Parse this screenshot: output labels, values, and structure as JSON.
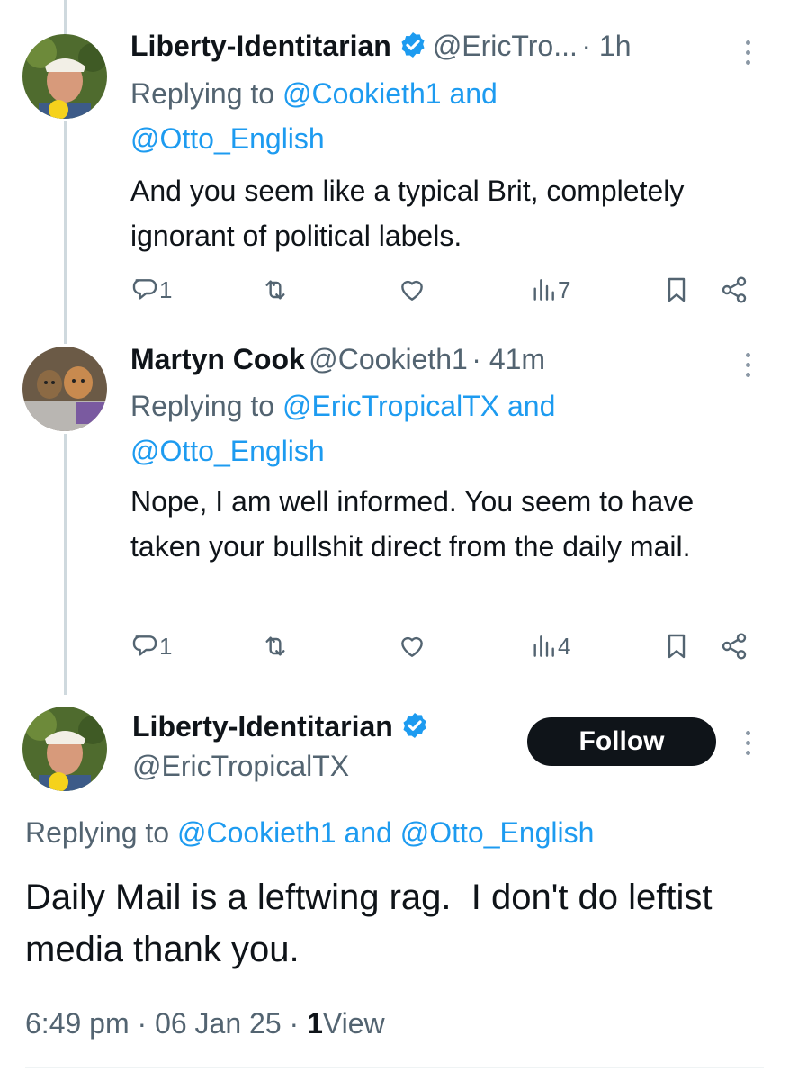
{
  "tweets": [
    {
      "name": "Liberty-Identitarian",
      "handle": "@EricTro...",
      "time": "· 1h",
      "replying_prefix": "Replying to",
      "replying_user1": "@Cookieth1",
      "replying_and": "and",
      "replying_user2": "@Otto_English",
      "text": "And you seem like a typical Brit, completely ignorant of political labels.",
      "replies": "1",
      "views": "7"
    },
    {
      "name": "Martyn Cook",
      "handle": "@Cookieth1",
      "time": "· 41m",
      "replying_prefix": "Replying to",
      "replying_user1": "@EricTropicalTX",
      "replying_and": "and",
      "replying_user2": "@Otto_English",
      "text": "Nope, I am well informed. You seem to have taken your bullshit direct from the daily mail.",
      "replies": "1",
      "views": "4"
    }
  ],
  "main_tweet": {
    "name": "Liberty-Identitarian",
    "handle": "@EricTropicalTX",
    "follow_label": "Follow",
    "replying_prefix": "Replying to",
    "replying_user1": "@Cookieth1",
    "replying_and": "and",
    "replying_user2": "@Otto_English",
    "text": "Daily Mail is a leftwing rag.  I don't do leftist media thank you.",
    "time": "6:49 pm",
    "sep1": "·",
    "date": "06 Jan 25",
    "sep2": "·",
    "views_count": "1",
    "views_label": "View"
  },
  "colors": {
    "accent": "#1d9bf0",
    "text": "#0f1419",
    "muted": "#536471",
    "button_bg": "#0f1419"
  },
  "icons": [
    "reply-icon",
    "retweet-icon",
    "like-icon",
    "views-icon",
    "bookmark-icon",
    "share-icon",
    "more-icon",
    "verified-icon"
  ]
}
